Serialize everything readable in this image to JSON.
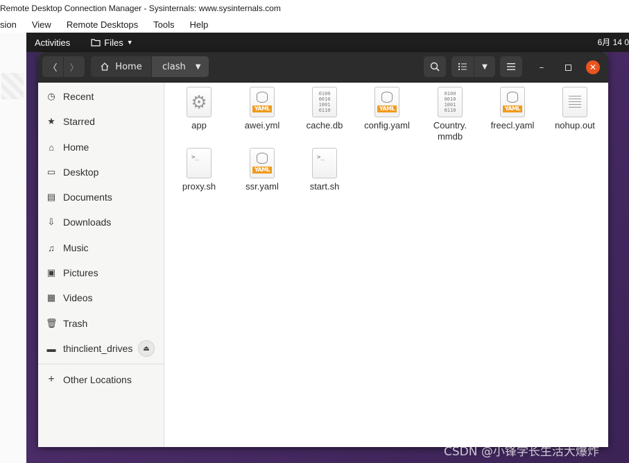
{
  "host": {
    "title": "Remote Desktop Connection Manager - Sysinternals: www.sysinternals.com",
    "menu": [
      "sion",
      "View",
      "Remote Desktops",
      "Tools",
      "Help"
    ]
  },
  "topbar": {
    "activities": "Activities",
    "files_menu": "Files",
    "clock": "6月 14  0"
  },
  "header": {
    "home_label": "Home",
    "current_folder": "clash"
  },
  "sidebar": {
    "items": [
      {
        "label": "Recent",
        "icon": "clock-icon"
      },
      {
        "label": "Starred",
        "icon": "star-icon"
      },
      {
        "label": "Home",
        "icon": "home-icon"
      },
      {
        "label": "Desktop",
        "icon": "desktop-icon"
      },
      {
        "label": "Documents",
        "icon": "document-icon"
      },
      {
        "label": "Downloads",
        "icon": "download-icon"
      },
      {
        "label": "Music",
        "icon": "music-icon"
      },
      {
        "label": "Pictures",
        "icon": "picture-icon"
      },
      {
        "label": "Videos",
        "icon": "video-icon"
      },
      {
        "label": "Trash",
        "icon": "trash-icon"
      },
      {
        "label": "thinclient_drives",
        "icon": "drive-icon"
      }
    ],
    "other_locations": "Other Locations"
  },
  "files": [
    {
      "name": "app",
      "type": "executable"
    },
    {
      "name": "awei.yml",
      "type": "yaml"
    },
    {
      "name": "cache.db",
      "type": "binary"
    },
    {
      "name": "config.yaml",
      "type": "yaml"
    },
    {
      "name": "Country.\nmmdb",
      "name_line1": "Country.",
      "name_line2": "mmdb",
      "type": "binary"
    },
    {
      "name": "freecl.yaml",
      "type": "yaml"
    },
    {
      "name": "nohup.out",
      "type": "text"
    },
    {
      "name": "proxy.sh",
      "type": "script"
    },
    {
      "name": "ssr.yaml",
      "type": "yaml"
    },
    {
      "name": "start.sh",
      "type": "script"
    }
  ],
  "icons": {
    "yaml_badge": "YAML",
    "binary_glyph_1": "0100",
    "binary_glyph_2": "0010",
    "binary_glyph_3": "1001",
    "binary_glyph_4": "0110",
    "script_glyph": ">_"
  },
  "colors": {
    "accent_close": "#e95420",
    "yaml_badge": "#f19a1a",
    "desktop_bg": "#4a2c66"
  },
  "watermark": "CSDN @小锋学长生活大爆炸"
}
